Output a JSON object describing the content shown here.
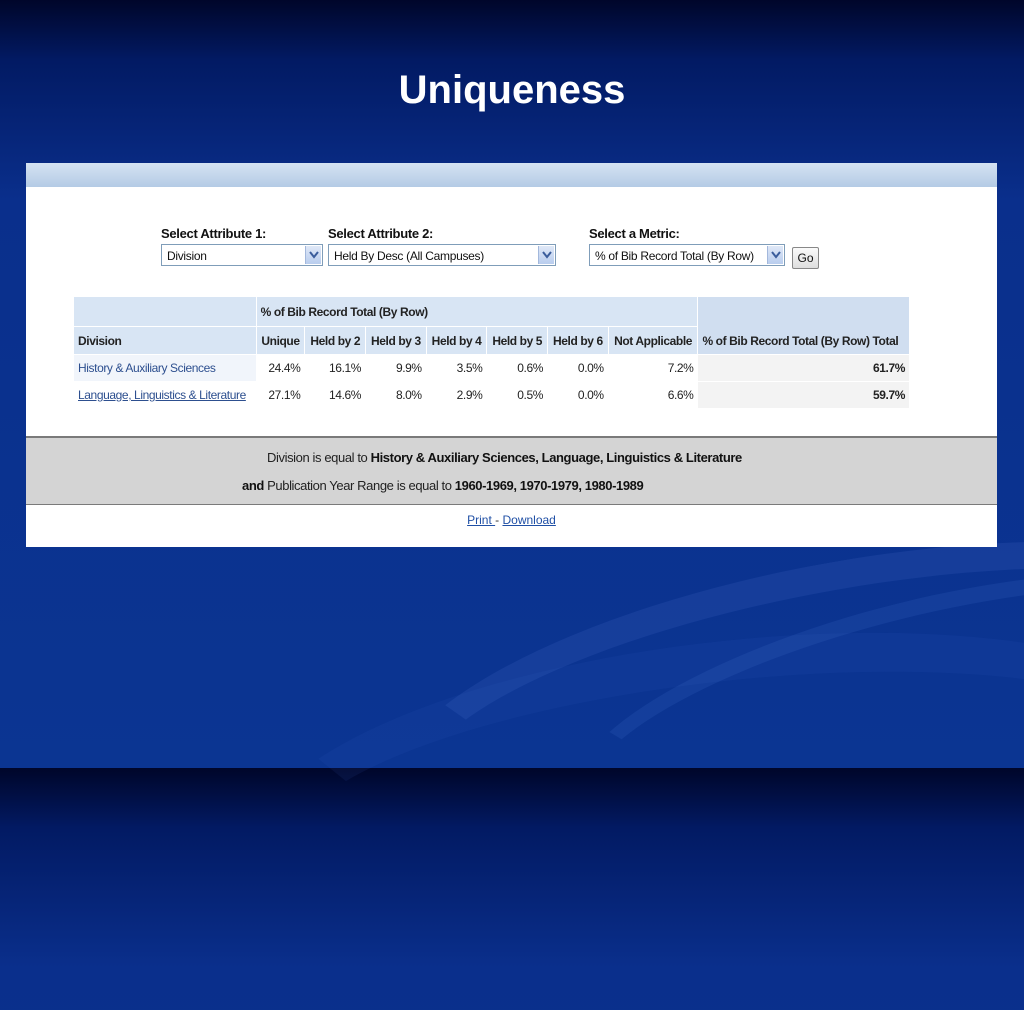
{
  "slide": {
    "title": "Uniqueness"
  },
  "selectors": {
    "attr1": {
      "label": "Select Attribute 1:",
      "value": "Division"
    },
    "attr2": {
      "label": "Select Attribute 2:",
      "value": "Held By Desc (All Campuses)"
    },
    "metric": {
      "label": "Select a Metric:",
      "value": "% of Bib Record Total (By Row)"
    },
    "go_label": "Go"
  },
  "table": {
    "group_header": "% of Bib Record Total (By Row)",
    "row_header": "Division",
    "columns": [
      "Unique",
      "Held by 2",
      "Held by 3",
      "Held by 4",
      "Held by 5",
      "Held by 6",
      "Not Applicable"
    ],
    "total_header": "% of Bib Record Total (By Row) Total",
    "rows": [
      {
        "division": "History & Auxiliary Sciences",
        "values": [
          "24.4%",
          "16.1%",
          "9.9%",
          "3.5%",
          "0.6%",
          "0.0%",
          "7.2%"
        ],
        "total": "61.7%"
      },
      {
        "division": "Language, Linguistics & Literature",
        "values": [
          "27.1%",
          "14.6%",
          "8.0%",
          "2.9%",
          "0.5%",
          "0.0%",
          "6.6%"
        ],
        "total": "59.7%"
      }
    ]
  },
  "filters": {
    "line1_prefix": "Division is equal to ",
    "line1_value": "History & Auxiliary Sciences, Language, Linguistics & Literature",
    "line2_and": "and",
    "line2_prefix": " Publication Year Range is equal to ",
    "line2_value": "1960-1969, 1970-1979, 1980-1989"
  },
  "links": {
    "print": "Print ",
    "separator": " - ",
    "download": "Download"
  },
  "colors": {
    "background": "#0b3592",
    "header_cell": "#d8e5f4",
    "link": "#1f4fa5",
    "filter_bg": "#d4d4d4"
  }
}
